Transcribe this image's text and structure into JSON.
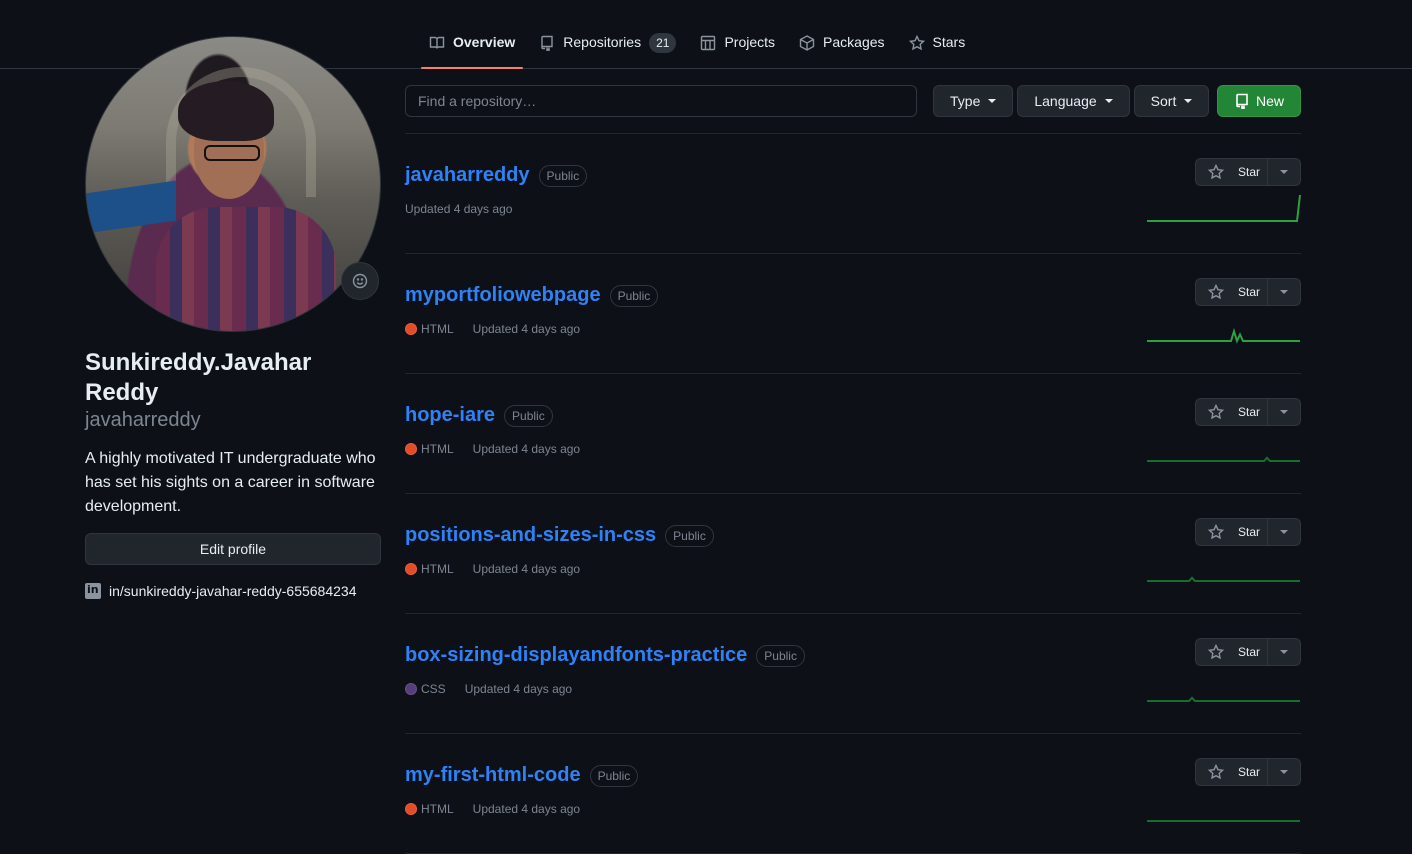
{
  "nav": {
    "tabs": [
      {
        "label": "Overview",
        "icon": "book-icon",
        "active": true
      },
      {
        "label": "Repositories",
        "icon": "repo-icon",
        "count": "21"
      },
      {
        "label": "Projects",
        "icon": "table-icon"
      },
      {
        "label": "Packages",
        "icon": "package-icon"
      },
      {
        "label": "Stars",
        "icon": "star-icon"
      }
    ]
  },
  "profile": {
    "fullname": "Sunkireddy.Javahar Reddy",
    "username": "javaharreddy",
    "bio": "A highly motivated IT undergraduate who has set his sights on a career in software development.",
    "edit_label": "Edit profile",
    "social_link": "in/sunkireddy-javahar-reddy-655684234",
    "social_icon": "linkedin-icon",
    "status_icon": "smiley-icon"
  },
  "filters": {
    "search_placeholder": "Find a repository…",
    "type_label": "Type",
    "language_label": "Language",
    "sort_label": "Sort",
    "new_label": "New"
  },
  "colors": {
    "accent_link": "#2f81f7",
    "tab_underline": "#f78166",
    "new_button": "#238636",
    "html_lang": "#e34c26",
    "css_lang": "#563d7c"
  },
  "repos": [
    {
      "name": "javaharreddy",
      "visibility": "Public",
      "language": "",
      "lang_color": "",
      "updated": "Updated 4 days ago",
      "star_label": "Star",
      "activity": [
        0,
        0,
        0,
        0,
        0,
        0,
        0,
        0,
        0,
        0,
        0,
        0,
        0,
        0,
        0,
        0,
        0,
        0,
        0,
        0,
        0,
        0,
        0,
        0,
        0,
        0,
        0,
        0,
        0,
        0,
        0,
        0,
        0,
        0,
        0,
        0,
        0,
        0,
        0,
        0,
        0,
        0,
        0,
        0,
        0,
        0,
        0,
        0,
        0,
        0,
        0,
        8
      ]
    },
    {
      "name": "myportfoliowebpage",
      "visibility": "Public",
      "language": "HTML",
      "lang_color": "#e34c26",
      "updated": "Updated 4 days ago",
      "star_label": "Star",
      "activity": [
        0,
        0,
        0,
        0,
        0,
        0,
        0,
        0,
        0,
        0,
        0,
        0,
        0,
        0,
        0,
        0,
        0,
        0,
        0,
        0,
        0,
        0,
        0,
        0,
        0,
        0,
        0,
        0,
        0,
        3,
        0,
        2,
        0,
        0,
        0,
        0,
        0,
        0,
        0,
        0,
        0,
        0,
        0,
        0,
        0,
        0,
        0,
        0,
        0,
        0,
        0,
        0
      ]
    },
    {
      "name": "hope-iare",
      "visibility": "Public",
      "language": "HTML",
      "lang_color": "#e34c26",
      "updated": "Updated 4 days ago",
      "star_label": "Star",
      "activity": [
        0,
        0,
        0,
        0,
        0,
        0,
        0,
        0,
        0,
        0,
        0,
        0,
        0,
        0,
        0,
        0,
        0,
        0,
        0,
        0,
        0,
        0,
        0,
        0,
        0,
        0,
        0,
        0,
        0,
        0,
        0,
        0,
        0,
        0,
        0,
        0,
        0,
        0,
        0,
        0,
        1,
        0,
        0,
        0,
        0,
        0,
        0,
        0,
        0,
        0,
        0,
        0
      ]
    },
    {
      "name": "positions-and-sizes-in-css",
      "visibility": "Public",
      "language": "HTML",
      "lang_color": "#e34c26",
      "updated": "Updated 4 days ago",
      "star_label": "Star",
      "activity": [
        0,
        0,
        0,
        0,
        0,
        0,
        0,
        0,
        0,
        0,
        0,
        0,
        0,
        0,
        0,
        1,
        0,
        0,
        0,
        0,
        0,
        0,
        0,
        0,
        0,
        0,
        0,
        0,
        0,
        0,
        0,
        0,
        0,
        0,
        0,
        0,
        0,
        0,
        0,
        0,
        0,
        0,
        0,
        0,
        0,
        0,
        0,
        0,
        0,
        0,
        0,
        0
      ]
    },
    {
      "name": "box-sizing-displayandfonts-practice",
      "visibility": "Public",
      "language": "CSS",
      "lang_color": "#563d7c",
      "updated": "Updated 4 days ago",
      "star_label": "Star",
      "activity": [
        0,
        0,
        0,
        0,
        0,
        0,
        0,
        0,
        0,
        0,
        0,
        0,
        0,
        0,
        0,
        1,
        0,
        0,
        0,
        0,
        0,
        0,
        0,
        0,
        0,
        0,
        0,
        0,
        0,
        0,
        0,
        0,
        0,
        0,
        0,
        0,
        0,
        0,
        0,
        0,
        0,
        0,
        0,
        0,
        0,
        0,
        0,
        0,
        0,
        0,
        0,
        0
      ]
    },
    {
      "name": "my-first-html-code",
      "visibility": "Public",
      "language": "HTML",
      "lang_color": "#e34c26",
      "updated": "Updated 4 days ago",
      "star_label": "Star",
      "activity": [
        0,
        0,
        0,
        0,
        0,
        0,
        0,
        0,
        0,
        0,
        0,
        0,
        0,
        0,
        0,
        0,
        0,
        0,
        0,
        0,
        0,
        0,
        0,
        0,
        0,
        0,
        0,
        0,
        0,
        0,
        0,
        0,
        0,
        0,
        0,
        0,
        0,
        0,
        0,
        0,
        0,
        0,
        0,
        0,
        0,
        0,
        0,
        0,
        0,
        0,
        0,
        0
      ]
    }
  ]
}
